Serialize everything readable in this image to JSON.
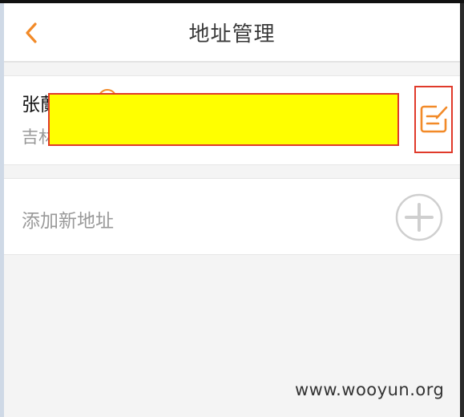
{
  "header": {
    "title": "地址管理",
    "back_icon": "chevron-left-icon",
    "accent_color": "#f28a28"
  },
  "address_card": {
    "name_partial": "张蘭",
    "address_partial": "吉林",
    "edit_icon": "edit-icon",
    "redacted": true
  },
  "add_address": {
    "label": "添加新地址",
    "icon": "plus-circle-icon"
  },
  "watermark": "www.wooyun.org"
}
